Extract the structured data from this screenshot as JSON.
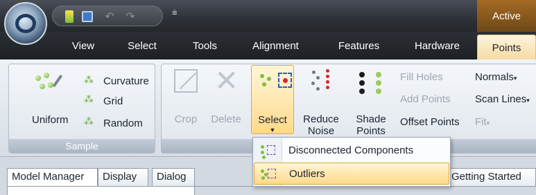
{
  "title_bar": {
    "active_label": "Active"
  },
  "tabs": {
    "view": "View",
    "select": "Select",
    "tools": "Tools",
    "alignment": "Alignment",
    "features": "Features",
    "hardware": "Hardware",
    "points": "Points"
  },
  "sample": {
    "uniform": "Uniform",
    "curvature": "Curvature",
    "grid": "Grid",
    "random": "Random",
    "caption": "Sample"
  },
  "points": {
    "crop": "Crop",
    "delete": "Delete",
    "select": "Select",
    "reduce_line1": "Reduce",
    "reduce_line2": "Noise",
    "shade_line1": "Shade",
    "shade_line2": "Points",
    "fill_holes": "Fill Holes",
    "add_points": "Add Points",
    "offset_points": "Offset Points",
    "normals": "Normals",
    "scan_lines": "Scan Lines",
    "fit": "Fit"
  },
  "dropdown": {
    "items": [
      "Disconnected Components",
      "Outliers"
    ]
  },
  "panels": {
    "model_manager": "Model Manager",
    "display": "Display",
    "dialog": "Dialog",
    "getting_started": "Getting Started"
  },
  "colors": {
    "accent": "#ffd98a",
    "accent_border": "#e0a640",
    "titlebar": "#2f333a",
    "active_tab": "#8a5a1e"
  }
}
